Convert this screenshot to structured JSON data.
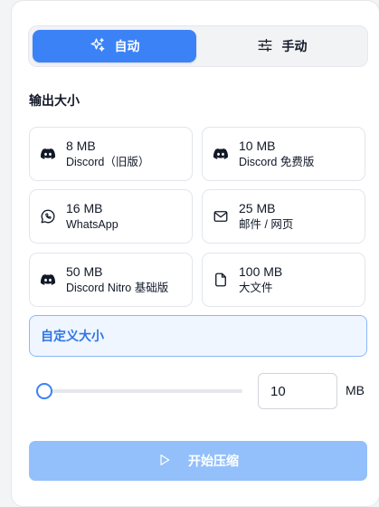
{
  "mode": {
    "auto_label": "自动",
    "manual_label": "手动",
    "active": "auto"
  },
  "output_size": {
    "title": "输出大小",
    "presets": [
      {
        "size": "8 MB",
        "label": "Discord（旧版）",
        "icon": "discord-icon"
      },
      {
        "size": "10 MB",
        "label": "Discord 免费版",
        "icon": "discord-icon"
      },
      {
        "size": "16 MB",
        "label": "WhatsApp",
        "icon": "whatsapp-icon"
      },
      {
        "size": "25 MB",
        "label": "邮件 / 网页",
        "icon": "mail-icon"
      },
      {
        "size": "50 MB",
        "label": "Discord Nitro 基础版",
        "icon": "discord-icon"
      },
      {
        "size": "100 MB",
        "label": "大文件",
        "icon": "file-icon"
      }
    ]
  },
  "custom": {
    "label": "自定义大小",
    "value": "10",
    "unit": "MB",
    "slider_fraction": 0.02
  },
  "action": {
    "compress_label": "开始压缩",
    "enabled": false
  },
  "colors": {
    "accent": "#3b82f6",
    "accent_disabled": "#93c0fb",
    "custom_bg": "#eff6ff",
    "custom_border": "#8bb8f8"
  }
}
